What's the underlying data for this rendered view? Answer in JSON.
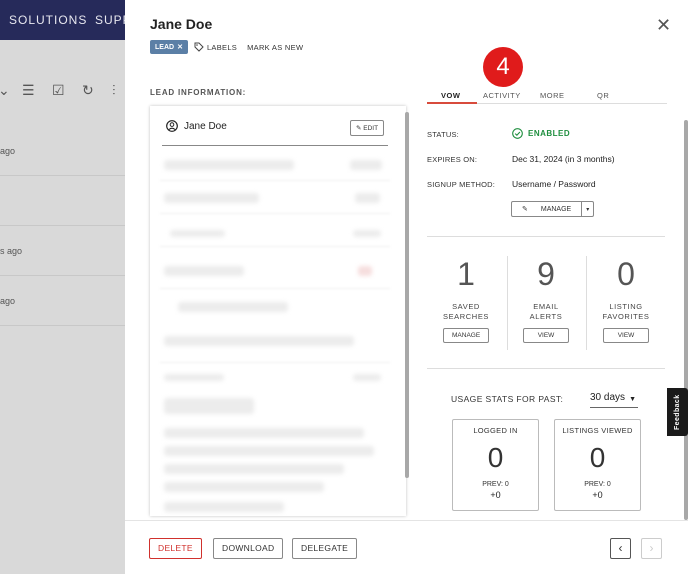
{
  "background": {
    "nav_items": [
      "SOLUTIONS",
      "SUPP"
    ],
    "toolbar_icons": [
      "sort-icon",
      "filter-icon",
      "checkbox-icon",
      "refresh-icon",
      "columns-icon"
    ],
    "rows": [
      "ago",
      "",
      "s ago",
      "ago"
    ]
  },
  "modal": {
    "title": "Jane Doe",
    "lead_badge": "LEAD",
    "labels_link": "LABELS",
    "mark_new": "MARK AS NEW",
    "section_label": "LEAD INFORMATION:",
    "lead_name": "Jane Doe",
    "edit_label": "EDIT"
  },
  "tabs": [
    "VOW",
    "ACTIVITY",
    "MORE",
    "QR"
  ],
  "callout_badge": "4",
  "vow": {
    "status_label": "STATUS:",
    "status_value": "ENABLED",
    "expires_label": "EXPIRES ON:",
    "expires_value": "Dec 31, 2024 (in 3 months)",
    "signup_label": "SIGNUP METHOD:",
    "signup_value": "Username / Password",
    "manage_label": "MANAGE",
    "stats": [
      {
        "value": "1",
        "label1": "SAVED",
        "label2": "SEARCHES",
        "button": "MANAGE"
      },
      {
        "value": "9",
        "label1": "EMAIL",
        "label2": "ALERTS",
        "button": "VIEW"
      },
      {
        "value": "0",
        "label1": "LISTING",
        "label2": "FAVORITES",
        "button": "VIEW"
      }
    ],
    "usage_label": "USAGE STATS FOR PAST:",
    "usage_period": "30 days",
    "usage": [
      {
        "title": "LOGGED IN",
        "value": "0",
        "prev": "PREV: 0",
        "delta": "+0"
      },
      {
        "title": "LISTINGS VIEWED",
        "value": "0",
        "prev": "PREV: 0",
        "delta": "+0"
      }
    ]
  },
  "feedback_label": "Feedback",
  "footer": {
    "delete": "DELETE",
    "download": "DOWNLOAD",
    "delegate": "DELEGATE",
    "prev": "‹",
    "next": "›"
  },
  "colors": {
    "nav_bg": "#262a5a",
    "lead_badge": "#5b7fa6",
    "accent_tab": "#d84b3c",
    "enabled_green": "#1e8e3e",
    "delete_red": "#d0312d",
    "callout_red": "#e01b1b"
  }
}
